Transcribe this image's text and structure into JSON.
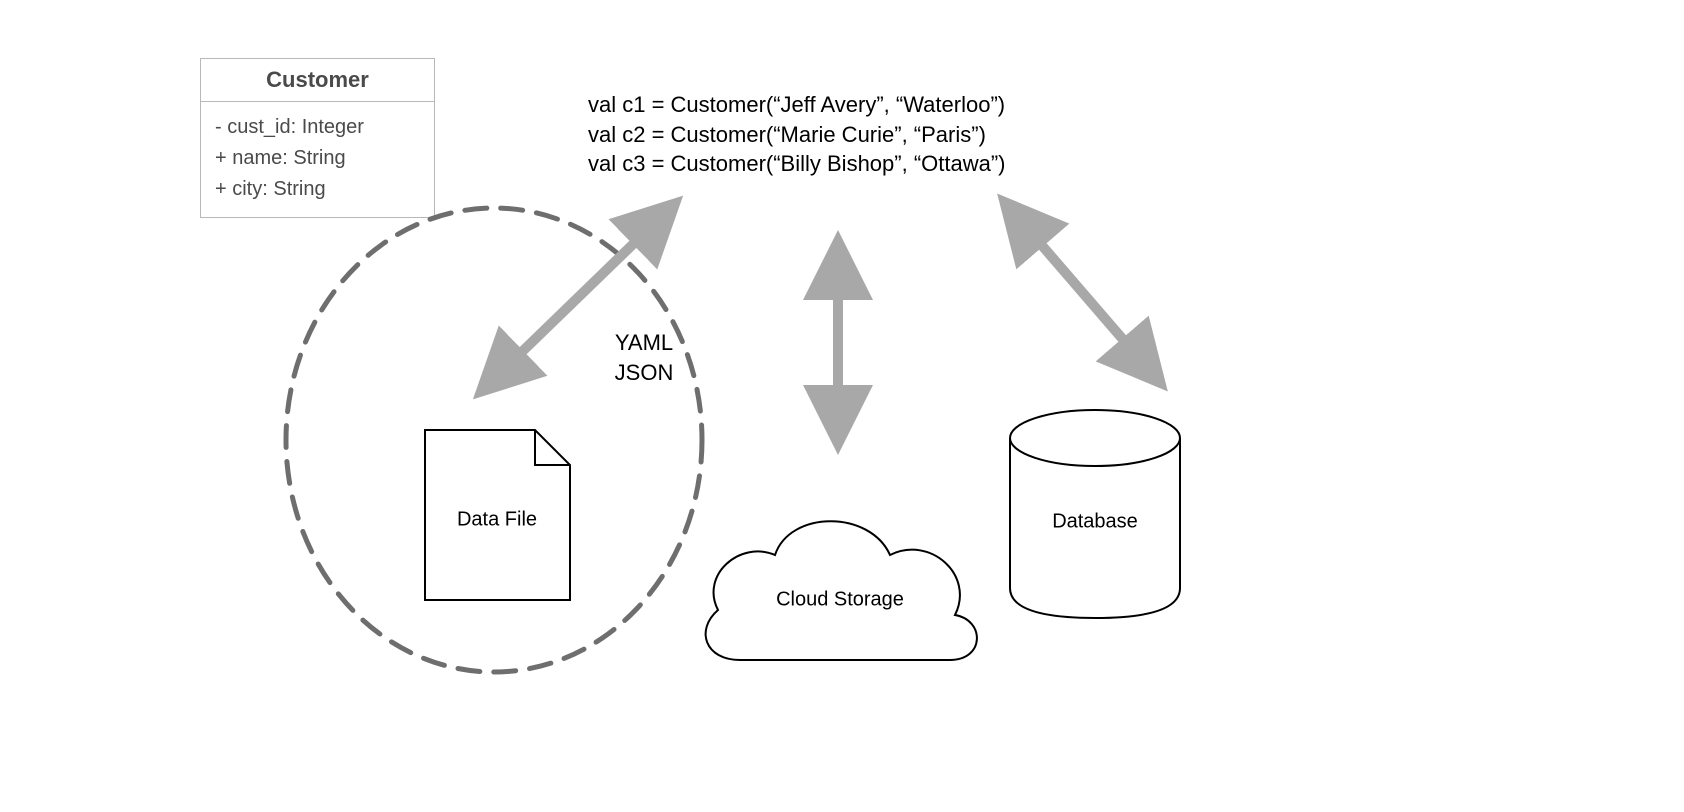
{
  "uml": {
    "title": "Customer",
    "attrs": [
      "- cust_id: Integer",
      "+ name: String",
      "+ city: String"
    ]
  },
  "code": {
    "line1": "val c1 = Customer(“Jeff Avery”, “Waterloo”)",
    "line2": "val c2 = Customer(“Marie Curie”, “Paris”)",
    "line3": "val c3 = Customer(“Billy Bishop”, “Ottawa”)"
  },
  "formats": {
    "line1": "YAML",
    "line2": "JSON"
  },
  "nodes": {
    "datafile": "Data File",
    "cloud": "Cloud Storage",
    "database": "Database"
  }
}
